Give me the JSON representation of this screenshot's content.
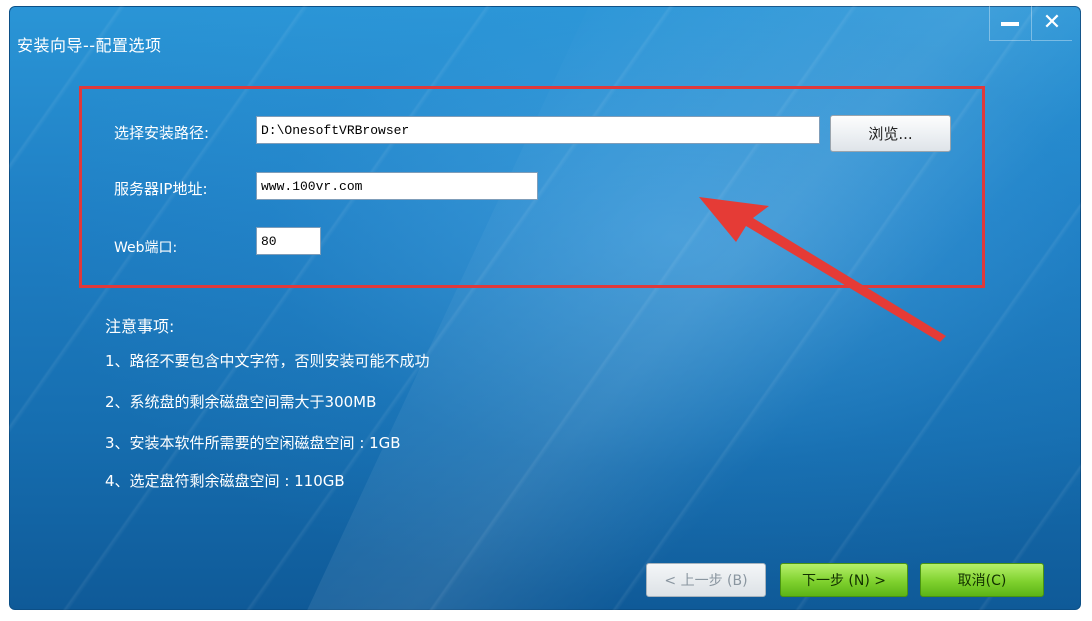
{
  "window": {
    "title": "安装向导--配置选项"
  },
  "form": {
    "path_label": "选择安装路径:",
    "path_value": "D:\\OnesoftVRBrowser",
    "browse_label": "浏览...",
    "server_label": "服务器IP地址:",
    "server_value": "www.100vr.com",
    "port_label": "Web端口:",
    "port_value": "80"
  },
  "notes": {
    "title": "注意事项:",
    "items": [
      "1、路径不要包含中文字符，否则安装可能不成功",
      "2、系统盘的剩余磁盘空间需大于300MB",
      "3、安装本软件所需要的空闲磁盘空间 : 1GB",
      "4、选定盘符剩余磁盘空间 : 110GB"
    ]
  },
  "buttons": {
    "prev": "< 上一步 (B)",
    "next": "下一步 (N) >",
    "cancel": "取消(C)"
  },
  "colors": {
    "highlight_border": "#e0393b",
    "arrow": "#e53b36",
    "accent_green": "#7fd12e",
    "window_blue": "#1f7fc4"
  },
  "icons": {
    "minimize": "minimize-icon",
    "close": "close-icon",
    "arrow": "annotation-arrow-icon"
  }
}
